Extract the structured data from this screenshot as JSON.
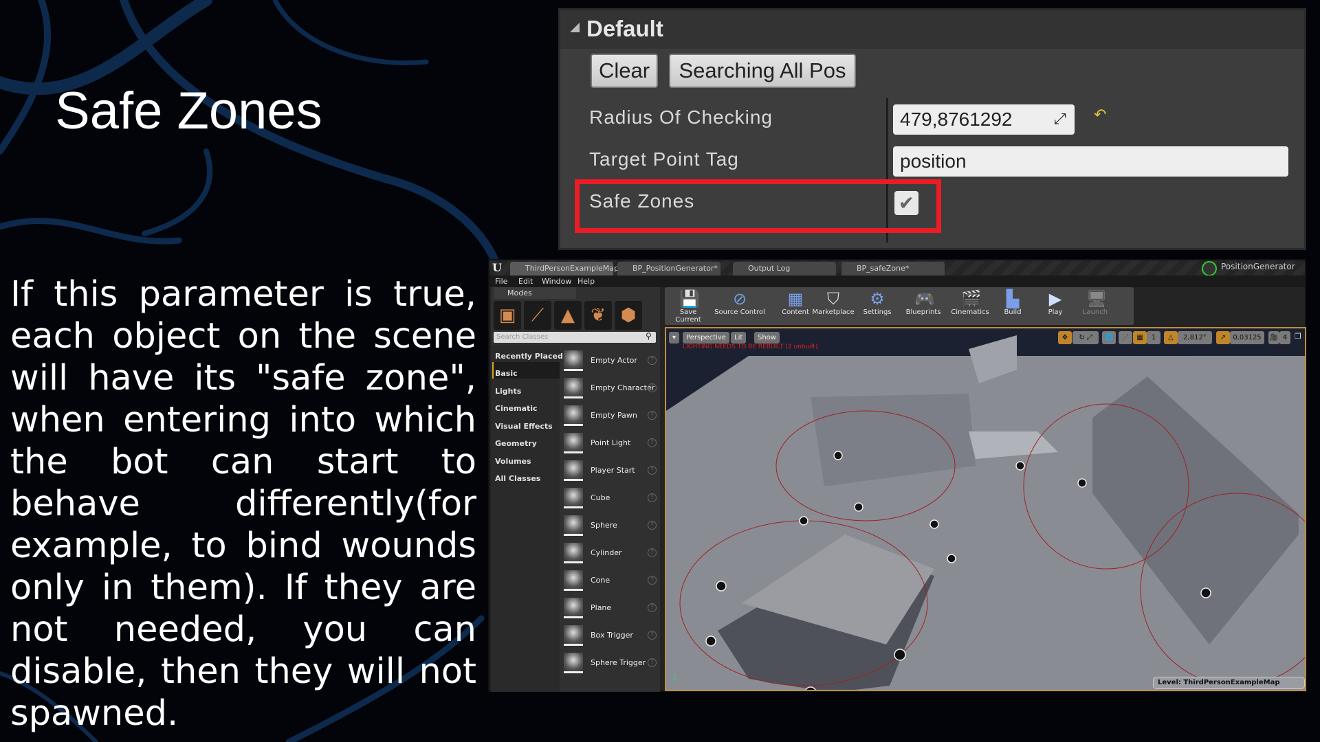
{
  "slide": {
    "title": "Safe Zones",
    "body": "If this parameter is true, each object on the scene will have its \"safe zone\", when entering into which the bot can start to behave differently(for example, to bind wounds only in them). If they are not needed, you can disable, then they will not spawned."
  },
  "details_panel": {
    "section": "Default",
    "buttons": {
      "clear": "Clear",
      "search": "Searching All Pos"
    },
    "properties": [
      {
        "label": "Radius Of Checking",
        "value": "479,8761292"
      },
      {
        "label": "Target Point Tag",
        "value": "position"
      },
      {
        "label": "Safe Zones",
        "checked": true
      }
    ],
    "highlight_color": "#ed1c24"
  },
  "editor": {
    "tabs": [
      "ThirdPersonExampleMap*",
      "BP_PositionGenerator*",
      "Output Log",
      "BP_safeZone*"
    ],
    "project": "PositionGenerator",
    "menu": [
      "File",
      "Edit",
      "Window",
      "Help"
    ],
    "modes": {
      "tab": "Modes",
      "search_placeholder": "Search Classes",
      "categories": [
        "Recently Placed",
        "Basic",
        "Lights",
        "Cinematic",
        "Visual Effects",
        "Geometry",
        "Volumes",
        "All Classes"
      ],
      "selected_category": "Basic",
      "items": [
        "Empty Actor",
        "Empty Character",
        "Empty Pawn",
        "Point Light",
        "Player Start",
        "Cube",
        "Sphere",
        "Cylinder",
        "Cone",
        "Plane",
        "Box Trigger",
        "Sphere Trigger"
      ]
    },
    "toolbar": [
      "Save Current",
      "Source Control",
      "Content",
      "Marketplace",
      "Settings",
      "Blueprints",
      "Cinematics",
      "Build",
      "Play",
      "Launch"
    ],
    "viewport": {
      "view_mode": "Perspective",
      "lighting": "Lit",
      "show": "Show",
      "warning": "LIGHTING NEEDS TO BE REBUILT (2 unbuilt)",
      "grid_snap": "1",
      "rotation_snap": "2,812°",
      "scale_snap": "0,03125",
      "camera_speed": "4",
      "level": "Level:  ThirdPersonExampleMap (Persistent)"
    }
  }
}
